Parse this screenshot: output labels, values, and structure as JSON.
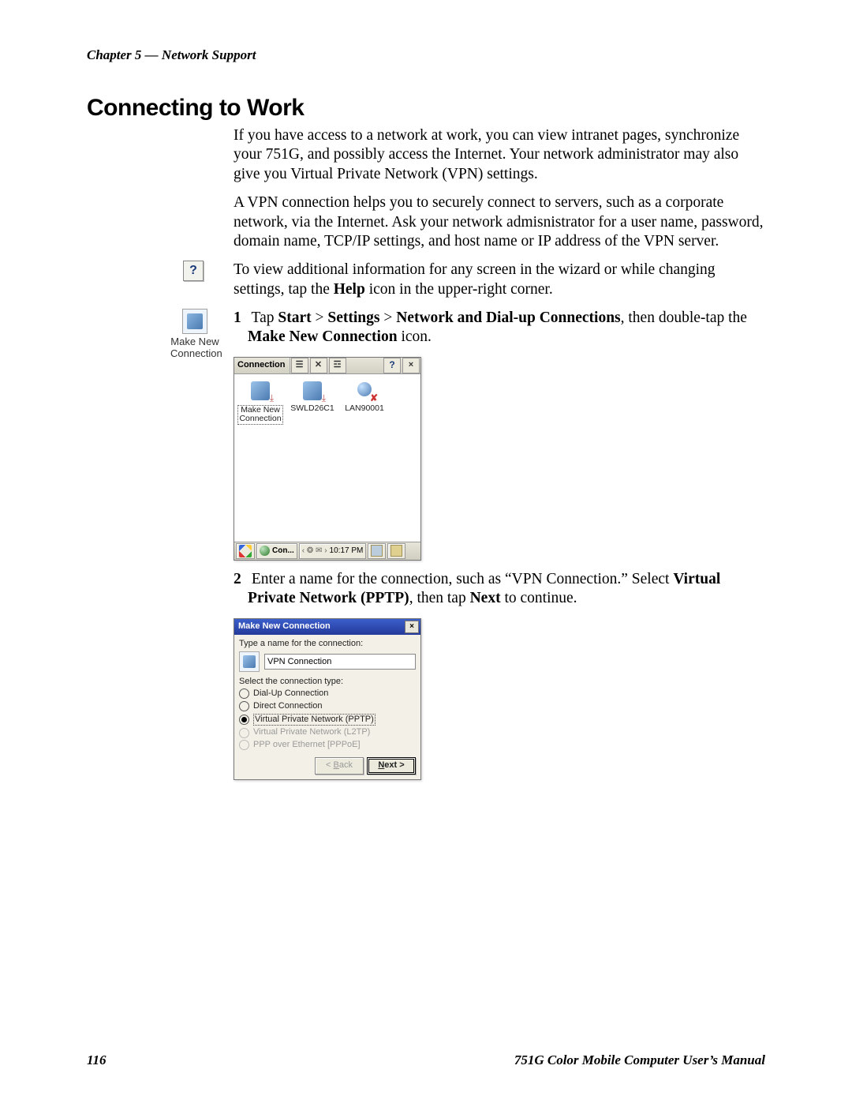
{
  "header": {
    "chapter": "Chapter 5 — Network Support"
  },
  "section": {
    "title": "Connecting to Work"
  },
  "paragraphs": {
    "p1": "If you have access to a network at work, you can view intranet pages, synchronize your 751G, and possibly access the Internet. Your network administrator may also give you Virtual Private Network (VPN) settings.",
    "p2": "A VPN connection helps you to securely connect to servers, such as a corporate network, via the Internet. Ask your network admisnistrator for a user name, password, domain name, TCP/IP settings, and host name or IP address of the VPN server.",
    "p3a": "To view additional information for any screen in the wizard or while changing settings, tap the ",
    "p3b": "Help",
    "p3c": " icon in the upper-right corner."
  },
  "sideIcon": {
    "help_label": "?",
    "makeNew_line1": "Make New",
    "makeNew_line2": "Connection"
  },
  "steps": {
    "s1_num": "1",
    "s1_a": "Tap ",
    "s1_b": "Start",
    "s1_gt": " > ",
    "s1_c": "Settings",
    "s1_d": "Network and Dial-up Connections",
    "s1_e": ", then double-tap the ",
    "s1_f": "Make New Connection",
    "s1_g": " icon.",
    "s2_num": "2",
    "s2_a": "Enter a name for the connection, such as “VPN Connection.” Select ",
    "s2_b": "Virtual Private Network (PPTP)",
    "s2_c": ", then tap ",
    "s2_d": "Next",
    "s2_e": " to continue."
  },
  "win1": {
    "title": "Connection",
    "items": {
      "makeNew": "Make New\nConnection",
      "swld": "SWLD26C1",
      "lan": "LAN90001"
    },
    "taskbar": {
      "task": "Con...",
      "time": "10:17 PM",
      "icons": "‹ ❂ ✉ ›"
    }
  },
  "wiz": {
    "title": "Make New Connection",
    "prompt1": "Type a name for the connection:",
    "input_value": "VPN Connection",
    "prompt2": "Select the connection type:",
    "options": {
      "o1": "Dial-Up Connection",
      "o2": "Direct Connection",
      "o3": "Virtual Private Network (PPTP)",
      "o4": "Virtual Private Network (L2TP)",
      "o5": "PPP over Ethernet [PPPoE]"
    },
    "btn_back_pre": "< ",
    "btn_back_u": "B",
    "btn_back_post": "ack",
    "btn_next_u": "N",
    "btn_next_post": "ext >"
  },
  "footer": {
    "page": "116",
    "manual": "751G Color Mobile Computer User’s Manual"
  }
}
